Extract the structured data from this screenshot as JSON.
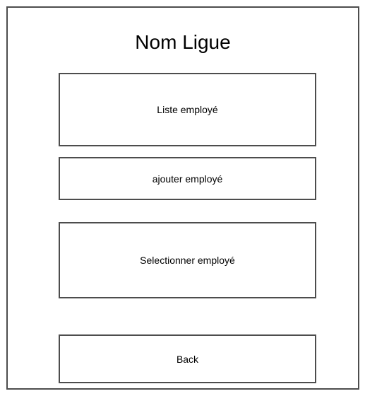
{
  "page": {
    "title": "Nom Ligue"
  },
  "menu": {
    "liste_employe_label": "Liste employé",
    "ajouter_employe_label": "ajouter employé",
    "selectionner_employe_label": "Selectionner employé",
    "back_label": "Back"
  },
  "colors": {
    "border": "#4d4d4d",
    "background": "#ffffff",
    "text": "#000000"
  }
}
